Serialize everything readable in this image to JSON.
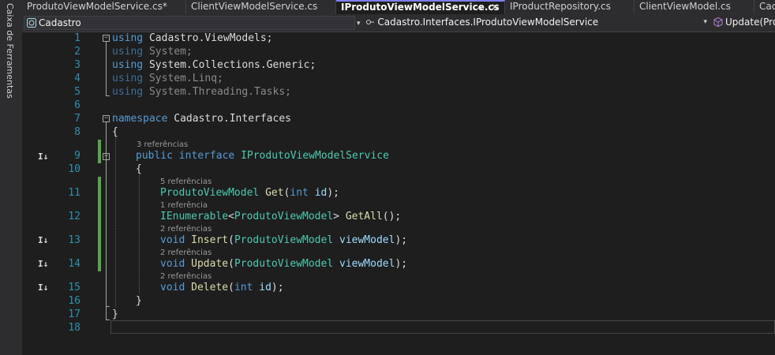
{
  "sidebar": {
    "label": "Caixa de Ferramentas"
  },
  "tabs": [
    {
      "label": "ProdutoViewModelService.cs*",
      "active": false
    },
    {
      "label": "ClientViewModelService.cs",
      "active": false
    },
    {
      "label": "IProdutoViewModelService.cs",
      "active": true
    },
    {
      "label": "IProductRepository.cs",
      "active": false
    },
    {
      "label": "ClientViewModel.cs",
      "active": false
    },
    {
      "label": "Cad",
      "active": false
    }
  ],
  "tab_pin": "⊸",
  "tab_close": "✕",
  "navbar": {
    "project": "Cadastro",
    "type": "Cadastro.Interfaces.IProdutoViewModelService",
    "member": "Update(Pro"
  },
  "editor": {
    "lines": {
      "l1": {
        "kw": "using",
        "ns": "Cadastro.ViewModels;"
      },
      "l2": {
        "kw": "using",
        "ns": "System;"
      },
      "l3": {
        "kw": "using",
        "ns": "System.Collections.Generic;"
      },
      "l4": {
        "kw": "using",
        "ns": "System.Linq;"
      },
      "l5": {
        "kw": "using",
        "ns": "System.Threading.Tasks;"
      },
      "l7": {
        "kw": "namespace",
        "ns": "Cadastro.Interfaces"
      },
      "l8": {
        "brace": "{"
      },
      "l9": {
        "mod": "public",
        "kw": "interface",
        "name": "IProdutoViewModelService"
      },
      "l10": {
        "brace": "{"
      },
      "l11": {
        "ret": "ProdutoViewModel",
        "fn": "Get",
        "open": "(",
        "ptype": "int",
        "pname": "id",
        "close": ");"
      },
      "l12": {
        "ret": "IEnumerable",
        "lt": "<",
        "targ": "ProdutoViewModel",
        "gt": ">",
        "fn": "GetAll",
        "close": "();"
      },
      "l13": {
        "ret": "void",
        "fn": "Insert",
        "open": "(",
        "ptype": "ProdutoViewModel",
        "pname": "viewModel",
        "close": ");"
      },
      "l14": {
        "ret": "void",
        "fn": "Update",
        "open": "(",
        "ptype": "ProdutoViewModel",
        "pname": "viewModel",
        "close": ");"
      },
      "l15": {
        "ret": "void",
        "fn": "Delete",
        "open": "(",
        "ptype": "int",
        "pname": "id",
        "close": ");"
      },
      "l16": {
        "brace": "}"
      },
      "l17": {
        "brace": "}"
      }
    },
    "line_numbers": [
      "1",
      "2",
      "3",
      "4",
      "5",
      "6",
      "7",
      "8",
      "9",
      "10",
      "11",
      "12",
      "13",
      "14",
      "15",
      "16",
      "17",
      "18"
    ],
    "codelens": {
      "interface": "3 referências",
      "get": "5 referências",
      "getall": "1 referência",
      "insert": "2 referências",
      "update": "2 referências",
      "delete": "2 referências"
    },
    "gutter_glyph": "I↓"
  },
  "colors": {
    "keyword": "#569cd6",
    "type": "#4ec9b0",
    "method": "#dcdcaa",
    "parameter": "#9cdcfe",
    "line_number": "#2b91af",
    "change_bar": "#57a64a",
    "active_tab_accent": "#7f7fff"
  },
  "icons": {
    "project_combo": "csharp-project-icon",
    "type_combo": "interface-icon",
    "member_combo": "method-cube-icon",
    "gutter": "implementation-navigation-icon"
  }
}
